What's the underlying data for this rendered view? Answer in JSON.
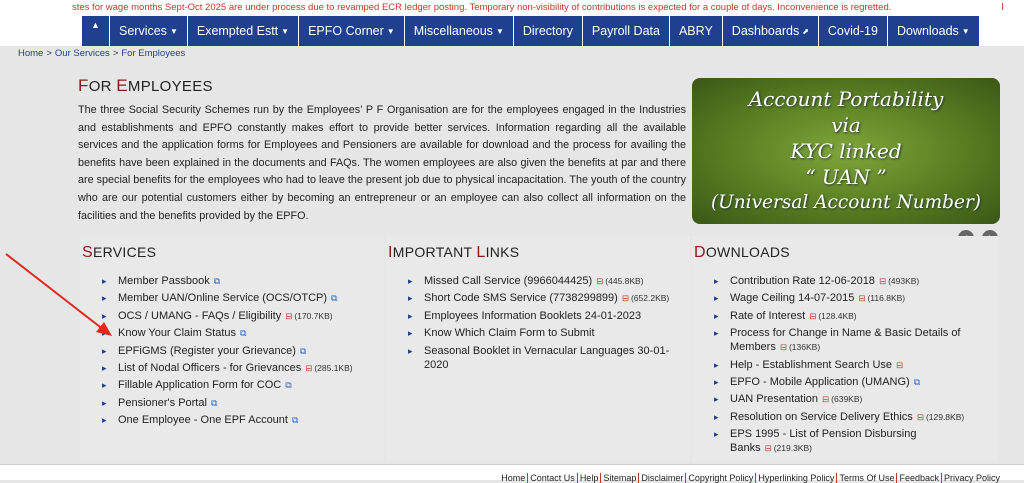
{
  "ticker": {
    "text": "stes for wage months Sept-Oct 2025 are under process due to revamped ECR ledger posting. Temporary non-visibility of contributions is expected for a couple of days. Inconvenience is regretted.",
    "cursor": "I"
  },
  "nav": {
    "home_icon": "home-icon",
    "items": [
      {
        "label": "Services",
        "caret": "▼"
      },
      {
        "label": "Exempted Estt",
        "caret": "▼"
      },
      {
        "label": "EPFO Corner",
        "caret": "▼"
      },
      {
        "label": "Miscellaneous",
        "caret": "▼"
      },
      {
        "label": "Directory"
      },
      {
        "label": "Payroll Data"
      },
      {
        "label": "ABRY"
      },
      {
        "label": "Dashboards",
        "caret": "⬈"
      },
      {
        "label": "Covid-19"
      },
      {
        "label": "Downloads",
        "caret": "▼"
      }
    ],
    "color": "#1f3f8f"
  },
  "breadcrumb": [
    "Home",
    "Our Services",
    "For Employees"
  ],
  "intro": {
    "title_first": "F",
    "title_rest1": "OR ",
    "title_second": "E",
    "title_rest2": "MPLOYEES",
    "text": "The three Social Security Schemes run by the Employees’ P F Organisation are for the employees engaged in the Industries and establishments and EPFO constantly makes effort to provide better services. Information regarding all the available services and the application forms for Employees and Pensioners are available for download and the process for availing the benefits have been explained in the documents and FAQs. The women employees are also given the benefits at par and there are special benefits for the employees who had to leave the present job due to physical incapacitation. The youth of the country who are our potential customers either by becoming an entrepreneur or an employee can also collect all information on the facilities and the benefits provided by the EPFO."
  },
  "banner": {
    "lines": [
      "Account Portability",
      "via",
      "KYC linked",
      "“ UAN ”",
      "(Universal Account Number)"
    ],
    "prev": "‹",
    "next": "›"
  },
  "services": {
    "title_cap": "S",
    "title_rest": "ERVICES",
    "items": [
      {
        "label": "Member Passbook",
        "icon": "external-link-icon"
      },
      {
        "label": "Member UAN/Online Service (OCS/OTCP)",
        "icon": "external-link-icon"
      },
      {
        "label": "OCS / UMANG - FAQs / Eligibility",
        "icon": "pdf-icon",
        "size": "(170.7KB)"
      },
      {
        "label": "Know Your Claim Status",
        "icon": "external-link-icon"
      },
      {
        "label": "EPFiGMS (Register your Grievance)",
        "icon": "external-link-icon"
      },
      {
        "label": "List of Nodal Officers - for Grievances",
        "icon": "pdf-icon",
        "size": "(285.1KB)"
      },
      {
        "label": "Fillable Application Form for COC",
        "icon": "external-link-icon"
      },
      {
        "label": "Pensioner's Portal",
        "icon": "external-link-icon"
      },
      {
        "label": "One Employee - One EPF Account",
        "icon": "external-link-icon"
      }
    ]
  },
  "links": {
    "title_cap": "I",
    "title_rest": "MPORTANT ",
    "title_cap2": "L",
    "title_rest2": "INKS",
    "items": [
      {
        "label": "Missed Call Service (9966044425)",
        "icon": "pdf-icon",
        "size": "(445.8KB)"
      },
      {
        "label": "Short Code SMS Service (7738299899)",
        "icon": "pdf-icon",
        "size": "(652.2KB)"
      },
      {
        "label": "Employees Information Booklets 24-01-2023"
      },
      {
        "label": "Know Which Claim Form to Submit"
      },
      {
        "label": "Seasonal Booklet in Vernacular Languages 30-01-2020"
      }
    ]
  },
  "downloads": {
    "title_cap": "D",
    "title_rest": "OWNLOADS",
    "items": [
      {
        "label": "Contribution Rate 12-06-2018",
        "icon": "pdf-icon",
        "size": "(493KB)"
      },
      {
        "label": "Wage Ceiling 14-07-2015",
        "icon": "pdf-icon",
        "size": "(116.8KB)"
      },
      {
        "label": "Rate of Interest",
        "icon": "pdf-icon",
        "size": "(128.4KB)"
      },
      {
        "label": "Process for Change in Name & Basic Details of Members",
        "icon": "pdf-icon",
        "size": "(136KB)"
      },
      {
        "label": "Help - Establishment Search Use",
        "icon": "pdf-icon"
      },
      {
        "label": "EPFO - Mobile Application (UMANG)",
        "icon": "external-link-icon"
      },
      {
        "label": "UAN Presentation",
        "icon": "pdf-icon",
        "size": "(639KB)"
      },
      {
        "label": "Resolution on Service Delivery Ethics",
        "icon": "pdf-icon",
        "size": "(129.8KB)"
      },
      {
        "label": "EPS 1995 - List of Pension Disbursing Banks",
        "icon": "pdf-icon",
        "size": "(219.3KB)"
      }
    ]
  },
  "footer": [
    "Home",
    "Contact Us",
    "Help",
    "Sitemap",
    "Disclaimer",
    "Copyright Policy",
    "Hyperlinking Policy",
    "Terms Of Use",
    "Feedback",
    "Privacy Policy"
  ],
  "glyphs": {
    "ext": "⧉",
    "pdf": "⊟",
    "sep": ">"
  }
}
